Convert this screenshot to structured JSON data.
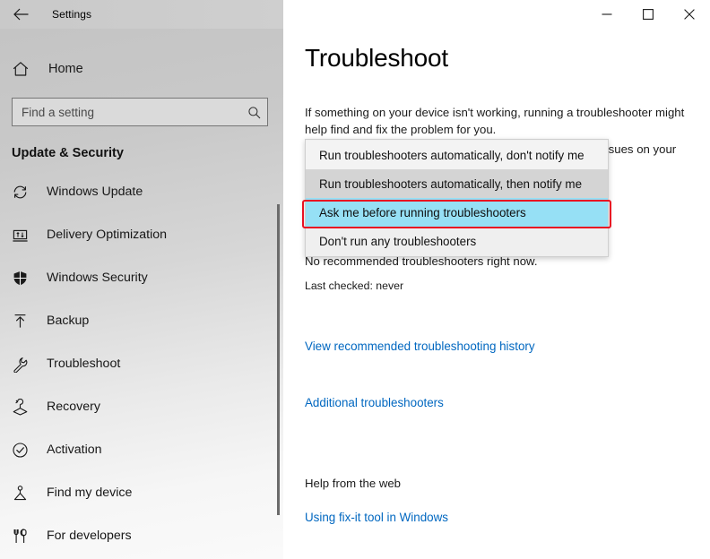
{
  "window": {
    "title": "Settings",
    "back_icon": "back-arrow-icon",
    "minimize_label": "Minimize",
    "maximize_label": "Maximize",
    "close_label": "Close"
  },
  "sidebar": {
    "home_label": "Home",
    "home_icon": "home-icon",
    "search": {
      "placeholder": "Find a setting",
      "value": "",
      "icon": "search-icon"
    },
    "section_title": "Update & Security",
    "items": [
      {
        "label": "Windows Update",
        "icon": "refresh-icon"
      },
      {
        "label": "Delivery Optimization",
        "icon": "delivery-icon"
      },
      {
        "label": "Windows Security",
        "icon": "shield-icon"
      },
      {
        "label": "Backup",
        "icon": "upload-arrow-icon"
      },
      {
        "label": "Troubleshoot",
        "icon": "wrench-icon"
      },
      {
        "label": "Recovery",
        "icon": "recovery-icon"
      },
      {
        "label": "Activation",
        "icon": "check-circle-icon"
      },
      {
        "label": "Find my device",
        "icon": "locate-person-icon"
      },
      {
        "label": "For developers",
        "icon": "tools-icon"
      }
    ]
  },
  "main": {
    "page_title": "Troubleshoot",
    "intro": "If something on your device isn't working, running a troubleshooter might help find and fix the problem for you.",
    "recommended_paragraph": "Recommended troubleshooting helps fix many detected issues on your device.",
    "status_line": "No recommended troubleshooters right now.",
    "last_checked": "Last checked: never",
    "link_history": "View recommended troubleshooting history",
    "link_additional": "Additional troubleshooters",
    "help_heading": "Help from the web",
    "link_fixit": "Using fix-it tool in Windows"
  },
  "dropdown": {
    "open": true,
    "options": [
      {
        "label": "Run troubleshooters automatically, don't notify me",
        "state": "plain"
      },
      {
        "label": "Run troubleshooters automatically, then notify me",
        "state": "selected"
      },
      {
        "label": "Ask me before running troubleshooters",
        "state": "hover"
      },
      {
        "label": "Don't run any troubleshooters",
        "state": "normal"
      }
    ]
  },
  "annotation": {
    "target_option": "Run troubleshooters automatically, then notify me",
    "color": "#e81123"
  },
  "colors": {
    "link": "#0067c0",
    "hover_highlight": "#96e0f5",
    "selected_item": "#d4d4d4",
    "dropdown_bg": "#efefef",
    "annotation_red": "#e81123"
  }
}
